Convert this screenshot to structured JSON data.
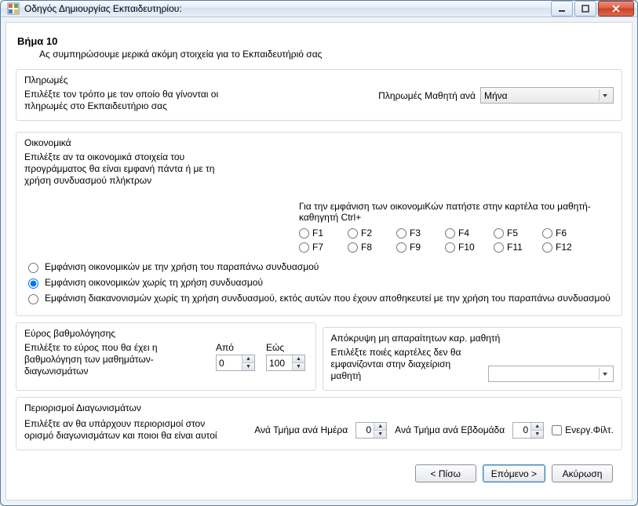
{
  "window": {
    "title": "Οδηγός Δημιουργίας Εκπαιδευτηρίου:"
  },
  "step": {
    "title": "Βήμα  10",
    "subtitle": "Ας συμπηρώσουμε μερικά ακόμη στοιχεία για το Εκπαιδευτήριό σας"
  },
  "payments": {
    "legend": "Πληρωμές",
    "desc": "Επιλέξτε τον τρόπο με τον οποίο θα γίνονται οι πληρωμές στο Εκπαιδευτήριο σας",
    "label": "Πληρωμές Μαθητή ανά",
    "value": "Μήνα"
  },
  "financial": {
    "legend": "Οικονομικά",
    "desc": "Επιλέξτε αν τα οικονομικά στοιχεία του προγράμματος θα είναι εμφανή πάντα ή με τη χρήση συνδυασμού πλήκτρων",
    "hotkey_caption": "Για την εμφάνιση των οικονομιKών πατήστε στην καρτέλα του μαθητή-καθηγητή Ctrl+",
    "fn_keys_row1": [
      "F1",
      "F2",
      "F3",
      "F4",
      "F5",
      "F6"
    ],
    "fn_keys_row2": [
      "F7",
      "F8",
      "F9",
      "F10",
      "F11",
      "F12"
    ],
    "display_options": {
      "opt1": "Εμφάνιση οικονομικών με την χρήση του παραπάνω συνδυασμού",
      "opt2": "Εμφάνιση οικονομικών χωρίς τη χρήση συνδυασμού",
      "opt3": "Εμφάνιση διακανονισμών χωρίς τη χρήση συνδυασμού, εκτός αυτών που έχουν αποθηκευτεί με την χρήση του παραπάνω συνδυασμού",
      "selected": "opt2"
    }
  },
  "grading": {
    "legend": "Εύρος βαθμολόγησης",
    "desc": "Επιλέξτε το εύρος που θα έχει η βαθμολόγηση των μαθημάτων-διαγωνισμάτων",
    "from_label": "Από",
    "to_label": "Εώς",
    "from_value": "0",
    "to_value": "100"
  },
  "hide_tabs": {
    "legend": "Απόκρυψη μη απαραίτητων καρ. μαθητή",
    "desc": "Επιλέξτε ποιές καρτέλες δεν θα εμφανίζονται στην διαχείριση μαθητή",
    "value": ""
  },
  "limits": {
    "legend": "Περιορισμοί Διαγωνισμάτων",
    "desc": "Επιλέξτε αν θα υπάρχουν περιορισμοί στον ορισμό διαγωνισμάτων και ποιοι θα είναι αυτοί",
    "per_day_label": "Ανά Τμήμα ανά Ημέρα",
    "per_day_value": "0",
    "per_week_label": "Ανά Τμήμα ανά Εβδομάδα",
    "per_week_value": "0",
    "filter_label": "Ενεργ.Φίλτ."
  },
  "buttons": {
    "back": "< Πίσω",
    "next": "Επόμενο >",
    "cancel": "Ακύρωση"
  }
}
